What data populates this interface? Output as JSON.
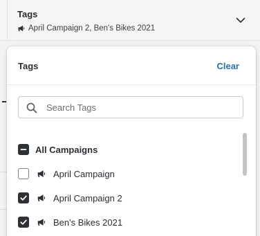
{
  "filter": {
    "title": "Tags",
    "value": "April Campaign 2, Ben's Bikes 2021",
    "value_icon": "megaphone-icon",
    "toggle_icon": "chevron-down-icon"
  },
  "panel": {
    "title": "Tags",
    "clear_label": "Clear",
    "search": {
      "placeholder": "Search Tags",
      "value": "",
      "icon": "search-icon"
    },
    "select_all": {
      "label": "All Campaigns",
      "state": "indeterminate"
    },
    "items": [
      {
        "label": "April Campaign",
        "checked": false,
        "icon": "megaphone-icon"
      },
      {
        "label": "April Campaign 2",
        "checked": true,
        "icon": "megaphone-icon"
      },
      {
        "label": "Ben's Bikes 2021",
        "checked": true,
        "icon": "megaphone-icon"
      }
    ]
  },
  "colors": {
    "accent_link": "#2a6fa8",
    "checkbox_fill": "#2e3135",
    "panel_bg": "#ffffff",
    "page_bg": "#f3f3f4"
  }
}
